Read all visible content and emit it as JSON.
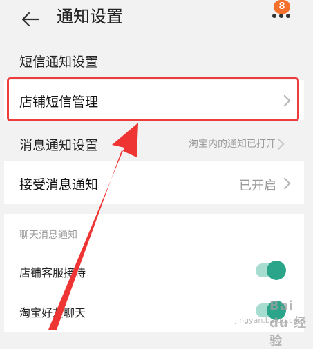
{
  "header": {
    "title": "通知设置",
    "badge_count": "8"
  },
  "sms_section": {
    "title": "短信通知设置"
  },
  "shop_sms": {
    "label": "店铺短信管理"
  },
  "msg_section": {
    "title": "消息通知设置",
    "status": "淘宝内的通知已打开"
  },
  "receive_msg": {
    "label": "接受消息通知",
    "value": "已开启"
  },
  "chat": {
    "title": "聊天消息通知",
    "items": [
      {
        "label": "店铺客服接待",
        "enabled": true
      },
      {
        "label": "淘宝好友聊天",
        "enabled": true
      }
    ]
  },
  "watermark": {
    "text": "Bai du 经验",
    "sub": "jingyan.baidu.com"
  },
  "colors": {
    "accent_green": "#2aa58a",
    "badge_orange": "#f5702a",
    "highlight_red": "#ee3b3b"
  }
}
